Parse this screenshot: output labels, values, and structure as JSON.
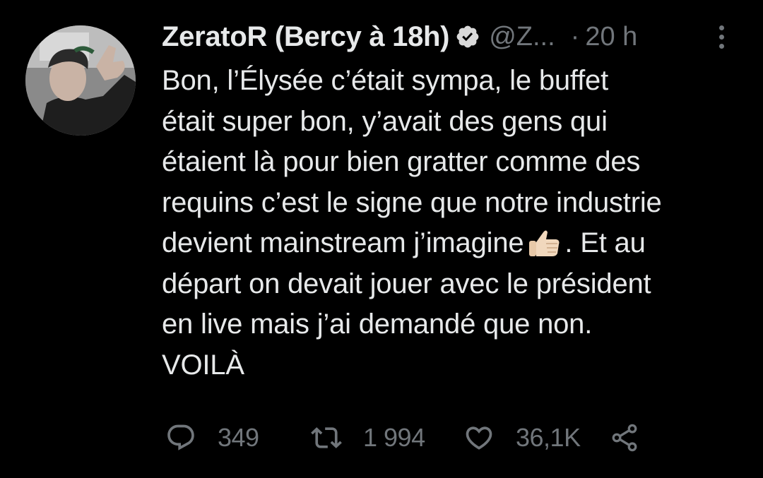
{
  "tweet": {
    "author": {
      "display_name": "ZeratoR (Bercy à 18h)",
      "handle": "@Z...",
      "verified": true,
      "avatar": "avatar-photo"
    },
    "separator": "·",
    "time": "20 h",
    "text_lines": [
      "Bon, l’Élysée c’était sympa, le buffet",
      "était super bon, y’avait des gens qui",
      "étaient là pour bien gratter comme des",
      "requins c’est le signe que notre industrie",
      "devient mainstream j’imagine",
      ". Et au",
      "départ on devait jouer avec le président",
      "en live mais j’ai demandé que non.",
      "VOILÀ"
    ],
    "emoji": "thumbs-up-light-skin-tone",
    "stats": {
      "replies": "349",
      "retweets": "1 994",
      "likes": "36,1K"
    }
  },
  "icons": {
    "more": "more-vertical-icon",
    "reply": "reply-icon",
    "retweet": "retweet-icon",
    "like": "heart-icon",
    "share": "share-icon",
    "verified": "verified-badge-icon"
  },
  "colors": {
    "background": "#000000",
    "primary_text": "#e7e9ea",
    "secondary_text": "#71767b"
  }
}
